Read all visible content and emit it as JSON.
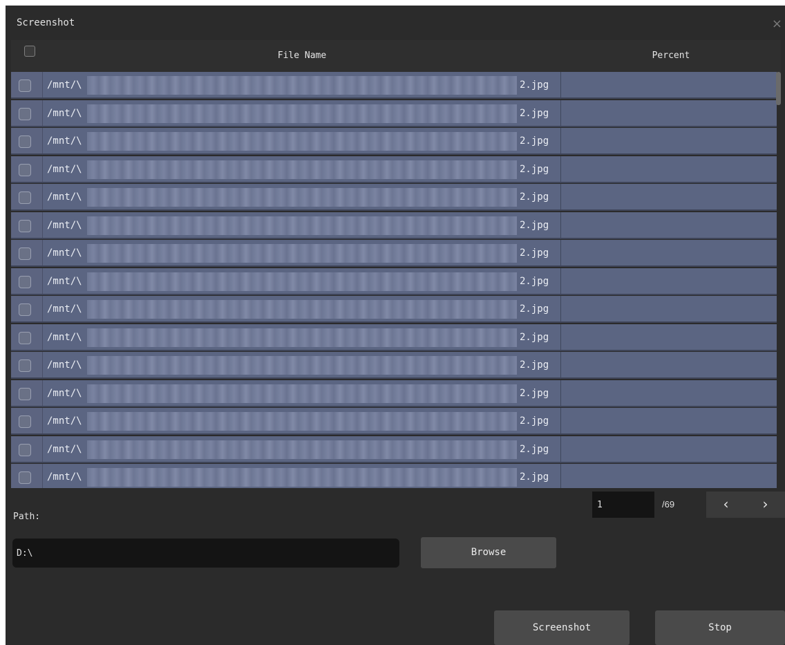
{
  "window": {
    "title": "Screenshot",
    "close_icon": "close-icon"
  },
  "table": {
    "headers": {
      "file_name": "File Name",
      "percent": "Percent"
    },
    "rows": [
      {
        "prefix": "/mnt/\\",
        "suffix": "2.jpg",
        "percent": ""
      },
      {
        "prefix": "/mnt/\\",
        "suffix": "2.jpg",
        "percent": ""
      },
      {
        "prefix": "/mnt/\\",
        "suffix": "2.jpg",
        "percent": ""
      },
      {
        "prefix": "/mnt/\\",
        "suffix": "2.jpg",
        "percent": ""
      },
      {
        "prefix": "/mnt/\\",
        "suffix": "2.jpg",
        "percent": ""
      },
      {
        "prefix": "/mnt/\\",
        "suffix": "2.jpg",
        "percent": ""
      },
      {
        "prefix": "/mnt/\\",
        "suffix": "2.jpg",
        "percent": ""
      },
      {
        "prefix": "/mnt/\\",
        "suffix": "2.jpg",
        "percent": ""
      },
      {
        "prefix": "/mnt/\\",
        "suffix": "2.jpg",
        "percent": ""
      },
      {
        "prefix": "/mnt/\\",
        "suffix": "2.jpg",
        "percent": ""
      },
      {
        "prefix": "/mnt/\\",
        "suffix": "2.jpg",
        "percent": ""
      },
      {
        "prefix": "/mnt/\\",
        "suffix": "2.jpg",
        "percent": ""
      },
      {
        "prefix": "/mnt/\\",
        "suffix": "2.jpg",
        "percent": ""
      },
      {
        "prefix": "/mnt/\\",
        "suffix": "2.jpg",
        "percent": ""
      },
      {
        "prefix": "/mnt/\\",
        "suffix": "2.jpg",
        "percent": ""
      }
    ]
  },
  "pagination": {
    "current": "1",
    "total": "/69",
    "prev_icon": "chevron-left-icon",
    "next_icon": "chevron-right-icon"
  },
  "path": {
    "label": "Path:",
    "value": "D:\\",
    "browse_label": "Browse"
  },
  "actions": {
    "screenshot_label": "Screenshot",
    "stop_label": "Stop"
  },
  "colors": {
    "row_bg": "#5b6582",
    "dialog_bg": "#2b2b2b",
    "button_bg": "#4a4a4a",
    "input_bg": "#141414"
  }
}
